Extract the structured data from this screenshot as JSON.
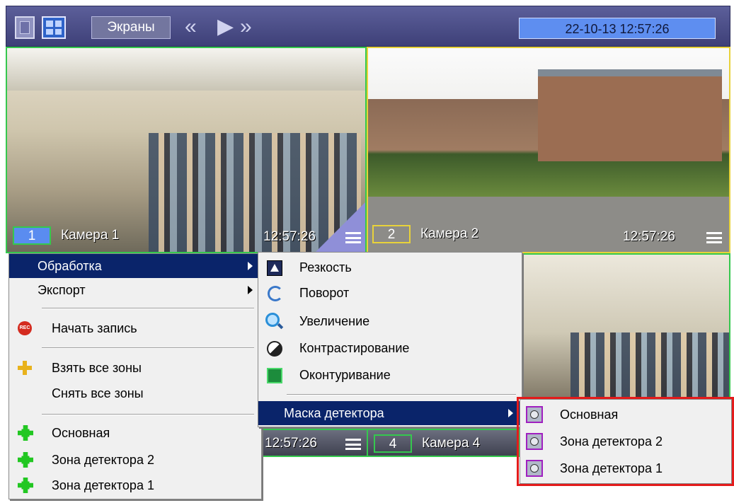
{
  "toolbar": {
    "screens_label": "Экраны",
    "prev_icon": "«",
    "play_icon": "▶",
    "next_icon": "»",
    "datetime": "22-10-13  12:57:26"
  },
  "cameras": [
    {
      "number": "1",
      "name": "Камера 1",
      "time": "12:57:26"
    },
    {
      "number": "2",
      "name": "Камера 2",
      "time": "12:57:26"
    },
    {
      "number": "4",
      "name": "Камера 4",
      "time": "12:57:26"
    }
  ],
  "context_menu": {
    "processing": "Обработка",
    "export": "Экспорт",
    "start_recording": "Начать запись",
    "rec_icon_text": "REC",
    "take_all_zones": "Взять все зоны",
    "release_all_zones": "Снять все зоны",
    "zone_main": "Основная",
    "zone_2": "Зона детектора 2",
    "zone_1": "Зона детектора 1"
  },
  "processing_menu": {
    "sharpness": "Резкость",
    "rotate": "Поворот",
    "zoom": "Увеличение",
    "contrast": "Контрастирование",
    "contour": "Оконтуривание",
    "detector_mask": "Маска детектора"
  },
  "mask_menu": {
    "main": "Основная",
    "zone_2": "Зона детектора 2",
    "zone_1": "Зона детектора 1"
  },
  "colors": {
    "menu_selection": "#0a246a",
    "highlight_border": "#e41b1b",
    "active_frame": "#35c84e",
    "camera2_frame": "#e8d23a"
  }
}
